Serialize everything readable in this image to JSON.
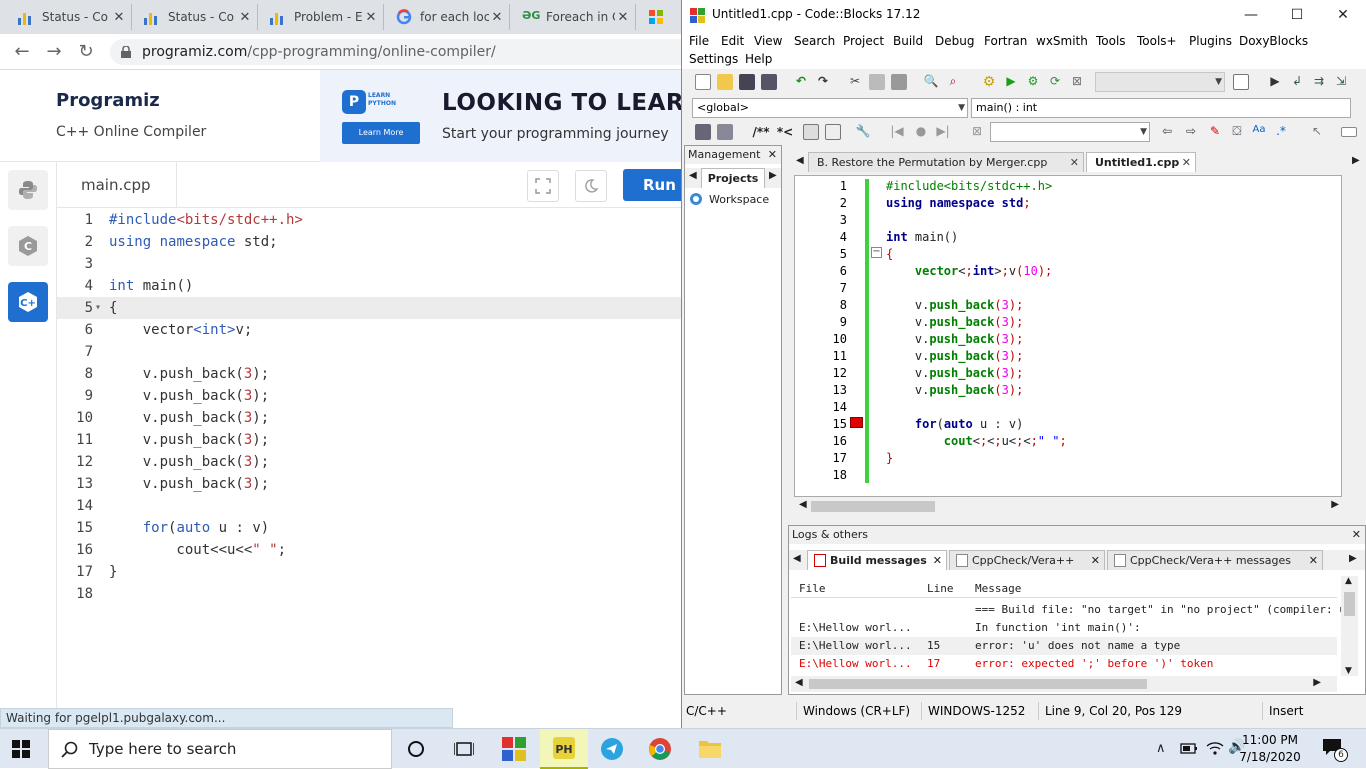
{
  "browser": {
    "tabs": [
      {
        "label": "Status - Co",
        "icon": "bar-chart-icon"
      },
      {
        "label": "Status - Co",
        "icon": "bar-chart-icon"
      },
      {
        "label": "Problem - E",
        "icon": "bar-chart-icon"
      },
      {
        "label": "for each loc",
        "icon": "google-icon"
      },
      {
        "label": "Foreach in C",
        "icon": "gfg-icon"
      }
    ],
    "url_domain": "programiz.com",
    "url_path": "/cpp-programming/online-compiler/",
    "status_text": "Waiting for pgelpl1.pubgalaxy.com..."
  },
  "programiz": {
    "logo": "Programiz",
    "subtitle": "C++ Online Compiler",
    "ad": {
      "badge_letter": "P",
      "badge_text": "LEARN PYTHON",
      "learn_more": "Learn More",
      "title": "LOOKING TO LEAR",
      "subtitle": "Start your programming journey"
    },
    "file_tab": "main.cpp",
    "run_label": "Run",
    "lines": [
      {
        "n": "1",
        "code": "#include<bits/stdc++.h>"
      },
      {
        "n": "2",
        "code": "using namespace std;"
      },
      {
        "n": "3",
        "code": ""
      },
      {
        "n": "4",
        "code": "int main()"
      },
      {
        "n": "5",
        "code": "{"
      },
      {
        "n": "6",
        "code": "    vector<int>v;"
      },
      {
        "n": "7",
        "code": ""
      },
      {
        "n": "8",
        "code": "    v.push_back(3);"
      },
      {
        "n": "9",
        "code": "    v.push_back(3);"
      },
      {
        "n": "10",
        "code": "    v.push_back(3);"
      },
      {
        "n": "11",
        "code": "    v.push_back(3);"
      },
      {
        "n": "12",
        "code": "    v.push_back(3);"
      },
      {
        "n": "13",
        "code": "    v.push_back(3);"
      },
      {
        "n": "14",
        "code": ""
      },
      {
        "n": "15",
        "code": "    for(auto u : v)"
      },
      {
        "n": "16",
        "code": "        cout<<u<<\" \";"
      },
      {
        "n": "17",
        "code": "}"
      },
      {
        "n": "18",
        "code": ""
      }
    ],
    "fold_marker": "▾"
  },
  "codeblocks": {
    "title": "Untitled1.cpp - Code::Blocks 17.12",
    "menu_row1": [
      "File",
      "Edit",
      "View",
      "Search",
      "Project",
      "Build",
      "Debug",
      "Fortran",
      "wxSmith",
      "Tools",
      "Tools+",
      "Plugins",
      "DoxyBlocks"
    ],
    "menu_row2": [
      "Settings",
      "Help"
    ],
    "scope_combo": "<global>",
    "func_combo": "main() : int",
    "comment_btn": "/**",
    "doc_btn": "*<",
    "management_title": "Management",
    "projects_tab": "Projects",
    "workspace": "Workspace",
    "editor_tabs": [
      {
        "label": "B. Restore the Permutation by Merger.cpp",
        "active": false
      },
      {
        "label": "Untitled1.cpp",
        "active": true
      }
    ],
    "lines": [
      {
        "n": "1",
        "code": "#include<bits/stdc++.h>"
      },
      {
        "n": "2",
        "code": "using namespace std;"
      },
      {
        "n": "3",
        "code": ""
      },
      {
        "n": "4",
        "code": "int main()"
      },
      {
        "n": "5",
        "code": "{"
      },
      {
        "n": "6",
        "code": "    vector<int>v(10);"
      },
      {
        "n": "7",
        "code": ""
      },
      {
        "n": "8",
        "code": "    v.push_back(3);"
      },
      {
        "n": "9",
        "code": "    v.push_back(3);"
      },
      {
        "n": "10",
        "code": "    v.push_back(3);"
      },
      {
        "n": "11",
        "code": "    v.push_back(3);"
      },
      {
        "n": "12",
        "code": "    v.push_back(3);"
      },
      {
        "n": "13",
        "code": "    v.push_back(3);"
      },
      {
        "n": "14",
        "code": ""
      },
      {
        "n": "15",
        "code": "    for(auto u : v)"
      },
      {
        "n": "16",
        "code": "        cout<<u<<\" \";"
      },
      {
        "n": "17",
        "code": "}"
      },
      {
        "n": "18",
        "code": ""
      }
    ],
    "logs_title": "Logs & others",
    "log_tabs": [
      "Build messages",
      "CppCheck/Vera++",
      "CppCheck/Vera++ messages"
    ],
    "log_headers": [
      "File",
      "Line",
      "Message"
    ],
    "log_rows": [
      {
        "file": "",
        "line": "",
        "msg": "=== Build file: \"no target\" in \"no project\" (compiler: unknown) ==="
      },
      {
        "file": "E:\\Hellow worl...",
        "line": "",
        "msg": "In function 'int main()':"
      },
      {
        "file": "E:\\Hellow worl...",
        "line": "15",
        "msg": "error: 'u' does not name a type"
      },
      {
        "file": "E:\\Hellow worl...",
        "line": "17",
        "msg": "error: expected ';' before ')' token"
      }
    ],
    "status": {
      "language": "C/C++",
      "eol": "Windows (CR+LF)",
      "encoding": "WINDOWS-1252",
      "position": "Line 9, Col 20, Pos 129",
      "mode": "Insert"
    }
  },
  "taskbar": {
    "search_placeholder": "Type here to search",
    "time": "11:00 PM",
    "date": "7/18/2020",
    "notif_count": "6"
  }
}
